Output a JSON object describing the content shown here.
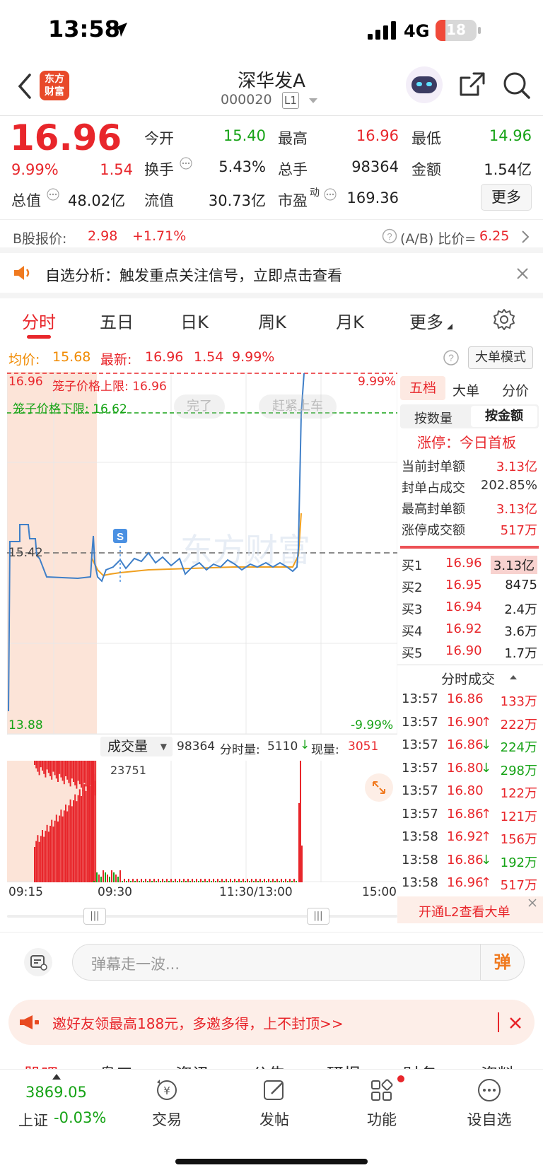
{
  "status": {
    "time": "13:58",
    "network": "4G",
    "battery": "18"
  },
  "header": {
    "logo": "东方\n财富",
    "title": "深华发A",
    "code": "000020",
    "level": "L1"
  },
  "quote": {
    "price": "16.96",
    "change_pct": "9.99%",
    "change": "1.54",
    "today_open_label": "今开",
    "today_open": "15.40",
    "high_label": "最高",
    "high": "16.96",
    "low_label": "最低",
    "low": "14.96",
    "turnover_label": "换手",
    "turnover": "5.43%",
    "total_hands_label": "总手",
    "total_hands": "98364",
    "amount_label": "金额",
    "amount": "1.54亿",
    "mkt_cap_label": "总值",
    "mkt_cap": "48.02亿",
    "float_label": "流值",
    "float_val": "30.73亿",
    "pe_label": "市盈",
    "pe_sup": "动",
    "pe": "169.36",
    "more": "更多"
  },
  "bshare": {
    "label": "B股报价:",
    "price": "2.98",
    "change": "+1.71%",
    "ratio_label": "(A/B) 比价=",
    "ratio": "6.25"
  },
  "promo": {
    "text": "自选分析：触发重点关注信号，立即点击查看"
  },
  "tabs": [
    "分时",
    "五日",
    "日K",
    "周K",
    "月K",
    "更多"
  ],
  "avg_line": {
    "avg_label": "均价:",
    "avg": "15.68",
    "latest_label": "最新:",
    "latest": "16.96",
    "chg": "1.54",
    "pct": "9.99%",
    "mode_btn": "大单模式"
  },
  "chart_labels": {
    "top_price": "16.96",
    "cage_upper": "笼子价格上限: 16.96",
    "cage_lower": "笼子价格下限: 16.62",
    "top_pct": "9.99%",
    "mid_price": "15.42",
    "bottom_price": "13.88",
    "bottom_pct": "-9.99%",
    "bubble1": "完了",
    "bubble2": "赶紧上车",
    "watermark": "东方财富",
    "s_marker": "S"
  },
  "volume_labels": {
    "selector": "成交量",
    "total": "98364",
    "fs_label": "分时量:",
    "fs": "5110",
    "now_label": "现量:",
    "now": "3051",
    "max": "23751"
  },
  "time_axis": [
    "09:15",
    "09:30",
    "11:30/13:00",
    "15:00"
  ],
  "right_panel": {
    "tabs": [
      "五档",
      "大单",
      "分价"
    ],
    "sub_tabs": [
      "按数量",
      "按金额"
    ],
    "limit_up": "涨停：今日首板",
    "stats": [
      {
        "label": "当前封单额",
        "value": "3.13亿"
      },
      {
        "label": "封单占成交",
        "value": "202.85%"
      },
      {
        "label": "最高封单额",
        "value": "3.13亿"
      },
      {
        "label": "涨停成交额",
        "value": "517万"
      }
    ],
    "bids": [
      {
        "label": "买1",
        "price": "16.96",
        "vol": "3.13亿"
      },
      {
        "label": "买2",
        "price": "16.95",
        "vol": "8475"
      },
      {
        "label": "买3",
        "price": "16.94",
        "vol": "2.4万"
      },
      {
        "label": "买4",
        "price": "16.92",
        "vol": "3.6万"
      },
      {
        "label": "买5",
        "price": "16.90",
        "vol": "1.7万"
      }
    ],
    "ticks_title": "分时成交",
    "ticks": [
      {
        "t": "13:57",
        "p": "16.86",
        "dir": "",
        "v": "133万",
        "c": "red"
      },
      {
        "t": "13:57",
        "p": "16.90",
        "dir": "↑",
        "v": "222万",
        "c": "red"
      },
      {
        "t": "13:57",
        "p": "16.86",
        "dir": "↓",
        "v": "224万",
        "c": "green"
      },
      {
        "t": "13:57",
        "p": "16.80",
        "dir": "↓",
        "v": "298万",
        "c": "green"
      },
      {
        "t": "13:57",
        "p": "16.80",
        "dir": "",
        "v": "122万",
        "c": "red"
      },
      {
        "t": "13:57",
        "p": "16.86",
        "dir": "↑",
        "v": "121万",
        "c": "red"
      },
      {
        "t": "13:58",
        "p": "16.92",
        "dir": "↑",
        "v": "156万",
        "c": "red"
      },
      {
        "t": "13:58",
        "p": "16.86",
        "dir": "↓",
        "v": "192万",
        "c": "green"
      },
      {
        "t": "13:58",
        "p": "16.96",
        "dir": "↑",
        "v": "517万",
        "c": "red"
      }
    ],
    "l2_banner": "开通L2查看大单"
  },
  "danmu": {
    "placeholder": "弹幕走一波...",
    "send": "弹"
  },
  "invite": {
    "text": "邀好友领最高188元，多邀多得，上不封顶>>"
  },
  "sub_tabs": [
    "股吧",
    "盘口",
    "资讯",
    "公告",
    "研报",
    "财务",
    "资料"
  ],
  "bottom_nav": {
    "index_value": "3869.05",
    "index_name": "上证",
    "index_change": "-0.03%",
    "items": [
      "交易",
      "发帖",
      "功能",
      "设自选"
    ]
  },
  "colors": {
    "up": "#e8262b",
    "down": "#16a316",
    "avg": "#f0a020",
    "price_line": "#3f7fc8",
    "accent": "#e8262b"
  }
}
